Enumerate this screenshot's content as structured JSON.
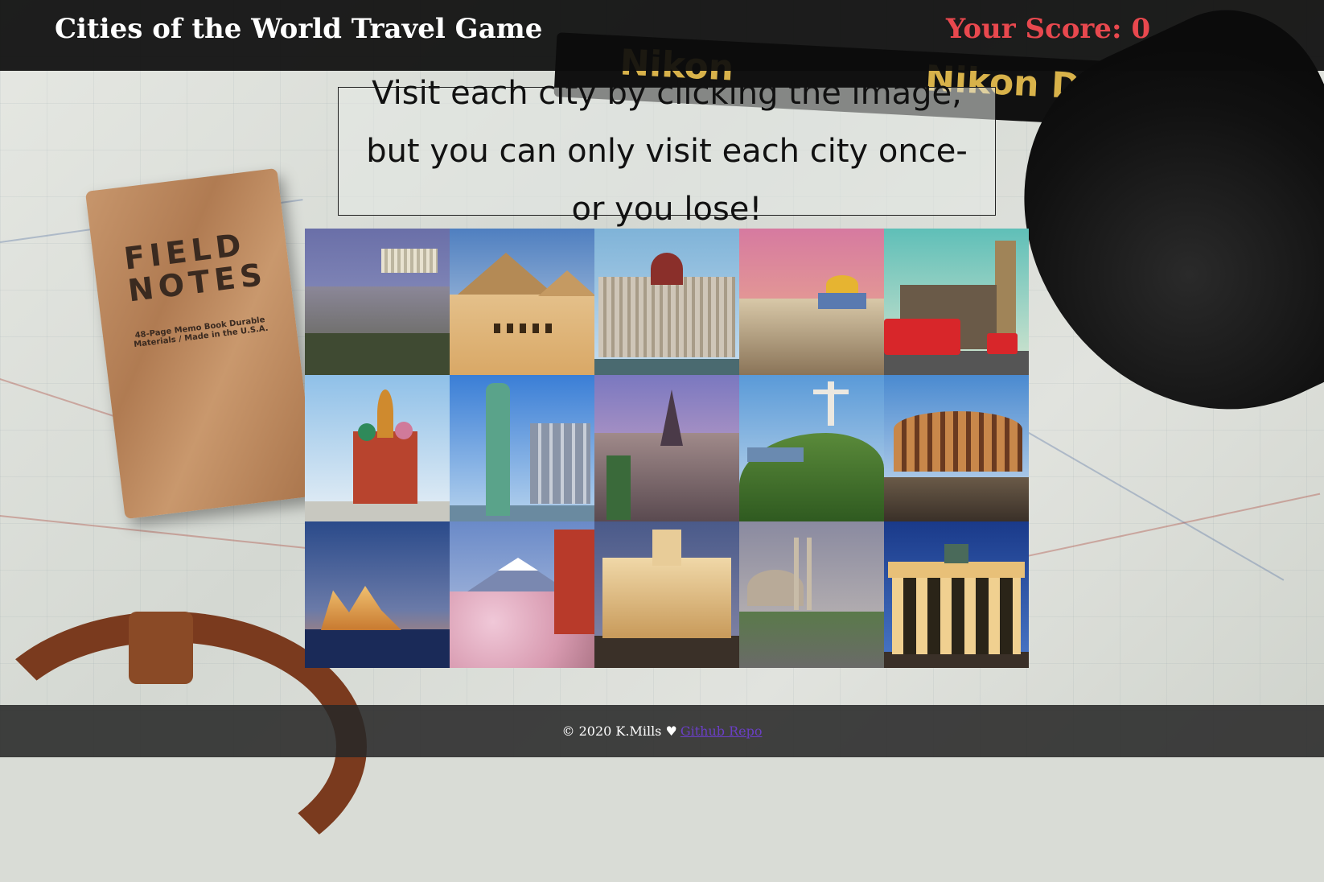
{
  "header": {
    "title": "Cities of the World Travel Game",
    "score_label": "Your Score:",
    "score_value": "0",
    "score_color": "#e8484e"
  },
  "instructions": "Visit each city by clicking the image, but you can only visit each city once- or you lose!",
  "background": {
    "notebook_title": "FIELD NOTES",
    "notebook_subtitle": "48-Page Memo Book Durable Materials / Made in the U.S.A.",
    "strap_text_1": "Nikon",
    "strap_text_2": "Nikon D4S"
  },
  "tiles": [
    {
      "landmark": "acropolis"
    },
    {
      "landmark": "pyramids"
    },
    {
      "landmark": "parliament-budapest"
    },
    {
      "landmark": "dome-of-the-rock"
    },
    {
      "landmark": "big-ben"
    },
    {
      "landmark": "st-basils-cathedral"
    },
    {
      "landmark": "statue-of-liberty"
    },
    {
      "landmark": "eiffel-tower"
    },
    {
      "landmark": "christ-the-redeemer"
    },
    {
      "landmark": "colosseum"
    },
    {
      "landmark": "sydney-opera-house"
    },
    {
      "landmark": "mount-fuji"
    },
    {
      "landmark": "cibeles-palace"
    },
    {
      "landmark": "blue-mosque"
    },
    {
      "landmark": "brandenburg-gate"
    }
  ],
  "footer": {
    "copyright": "© 2020 K.Mills ♥",
    "link_label": "Github Repo"
  }
}
